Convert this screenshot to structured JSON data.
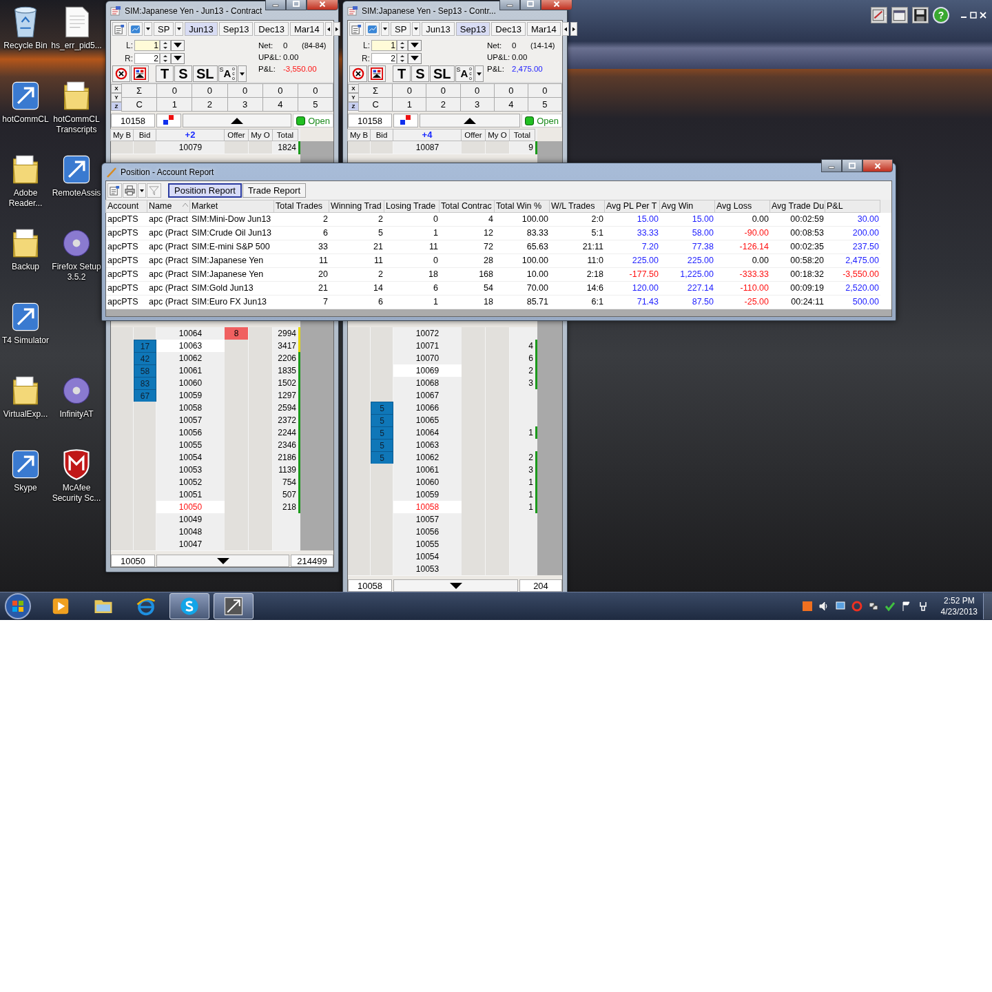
{
  "desktop": {
    "icons": [
      {
        "label": "Recycle Bin",
        "kind": "bin"
      },
      {
        "label": "hs_err_pid5...",
        "kind": "file"
      },
      {
        "label": "hotCommCL",
        "kind": "app"
      },
      {
        "label": "hotCommCL Transcripts",
        "kind": "folder"
      },
      {
        "label": "Adobe Reader...",
        "kind": "folder"
      },
      {
        "label": "RemoteAssis",
        "kind": "app"
      },
      {
        "label": "Backup",
        "kind": "folder"
      },
      {
        "label": "Firefox Setup 3.5.2",
        "kind": "disc"
      },
      {
        "label": "T4 Simulator",
        "kind": "app"
      },
      {
        "kind": "none"
      },
      {
        "label": "VirtualExp...",
        "kind": "folder"
      },
      {
        "label": "InfinityAT",
        "kind": "disc"
      },
      {
        "label": "Skype",
        "kind": "app"
      },
      {
        "label": "McAfee Security Sc...",
        "kind": "shield"
      }
    ]
  },
  "top_window": {
    "help": "?"
  },
  "ladders": [
    {
      "title": "SIM:Japanese Yen - Jun13 - Contract",
      "dropdown": "SP",
      "contracts": [
        {
          "label": "Jun13",
          "selected": true
        },
        {
          "label": "Sep13",
          "selected": false
        },
        {
          "label": "Dec13",
          "selected": false
        },
        {
          "label": "Mar14",
          "selected": false
        }
      ],
      "fields": [
        {
          "label": "L:",
          "value": "1"
        },
        {
          "label": "R:",
          "value": "2"
        }
      ],
      "stats": [
        {
          "label": "Net:",
          "value": "0",
          "extra": "(84-84)"
        },
        {
          "label": "UP&L:",
          "value": "0.00"
        },
        {
          "label": "P&L:",
          "value": "-3,550.00",
          "color": "#ff1010"
        }
      ],
      "order_buttons": [
        "T",
        "S",
        "SL"
      ],
      "oco": {
        "small": "S",
        "label": "A",
        "side": "oco"
      },
      "grid": {
        "axes": [
          {
            "label": "X",
            "selected": false
          },
          {
            "label": "Y",
            "selected": false
          },
          {
            "label": "Z",
            "selected": true
          }
        ],
        "sums": [
          "Σ",
          "0",
          "0",
          "0",
          "0",
          "0"
        ],
        "cols": [
          "C",
          "1",
          "2",
          "3",
          "4",
          "5"
        ]
      },
      "status": {
        "price": "10158",
        "state": "Open"
      },
      "columns": [
        "My B",
        "Bid",
        "+2",
        "Offer",
        "My O",
        "Total"
      ],
      "rows_top": [
        {
          "price": "10079",
          "total": "1824",
          "color": "#1a9a1a",
          "kind": "level"
        }
      ],
      "rows_bottom": [
        {
          "price": "10064",
          "offer": "8",
          "total": "2994",
          "color": "#e6d800",
          "kind": "level"
        },
        {
          "price": "10063",
          "bid": "17",
          "total": "3417",
          "color": "#e6d800",
          "kind": "inside"
        },
        {
          "price": "10062",
          "bid": "42",
          "total": "2206",
          "color": "#1a9a1a",
          "kind": "level"
        },
        {
          "price": "10061",
          "bid": "58",
          "total": "1835",
          "color": "#1a9a1a",
          "kind": "level"
        },
        {
          "price": "10060",
          "bid": "83",
          "total": "1502",
          "color": "#1a9a1a",
          "kind": "level"
        },
        {
          "price": "10059",
          "bid": "67",
          "total": "1297",
          "color": "#1a9a1a",
          "kind": "level"
        },
        {
          "price": "10058",
          "total": "2594",
          "color": "#1a9a1a",
          "kind": "level"
        },
        {
          "price": "10057",
          "total": "2372",
          "color": "#1a9a1a",
          "kind": "level"
        },
        {
          "price": "10056",
          "total": "2244",
          "color": "#1a9a1a",
          "kind": "level"
        },
        {
          "price": "10055",
          "total": "2346",
          "color": "#1a9a1a",
          "kind": "level"
        },
        {
          "price": "10054",
          "total": "2186",
          "color": "#1a9a1a",
          "kind": "level"
        },
        {
          "price": "10053",
          "total": "1139",
          "color": "#1a9a1a",
          "kind": "level"
        },
        {
          "price": "10052",
          "total": "754",
          "color": "#1a9a1a",
          "kind": "level"
        },
        {
          "price": "10051",
          "total": "507",
          "color": "#1a9a1a",
          "kind": "level"
        },
        {
          "price": "10050",
          "total": "218",
          "color": "#1a9a1a",
          "kind": "last"
        },
        {
          "price": "10049",
          "kind": "level"
        },
        {
          "price": "10048",
          "kind": "level"
        },
        {
          "price": "10047",
          "kind": "level"
        }
      ],
      "footer": {
        "price": "10050",
        "total": "214499"
      }
    },
    {
      "title": "SIM:Japanese Yen - Sep13 - Contr...",
      "dropdown": "SP",
      "contracts": [
        {
          "label": "Jun13",
          "selected": false
        },
        {
          "label": "Sep13",
          "selected": true
        },
        {
          "label": "Dec13",
          "selected": false
        },
        {
          "label": "Mar14",
          "selected": false
        }
      ],
      "fields": [
        {
          "label": "L:",
          "value": "1"
        },
        {
          "label": "R:",
          "value": "2"
        }
      ],
      "stats": [
        {
          "label": "Net:",
          "value": "0",
          "extra": "(14-14)"
        },
        {
          "label": "UP&L:",
          "value": "0.00"
        },
        {
          "label": "P&L:",
          "value": "2,475.00",
          "color": "#2020ff"
        }
      ],
      "order_buttons": [
        "T",
        "S",
        "SL"
      ],
      "oco": {
        "small": "S",
        "label": "A",
        "side": "oco"
      },
      "grid": {
        "axes": [
          {
            "label": "X",
            "selected": false
          },
          {
            "label": "Y",
            "selected": false
          },
          {
            "label": "Z",
            "selected": true
          }
        ],
        "sums": [
          "Σ",
          "0",
          "0",
          "0",
          "0",
          "0"
        ],
        "cols": [
          "C",
          "1",
          "2",
          "3",
          "4",
          "5"
        ]
      },
      "status": {
        "price": "10158",
        "state": "Open"
      },
      "columns": [
        "My B",
        "Bid",
        "+4",
        "Offer",
        "My O",
        "Total"
      ],
      "rows_top": [
        {
          "price": "10087",
          "total": "9",
          "color": "#1a9a1a",
          "kind": "level"
        }
      ],
      "rows_bottom": [
        {
          "price": "10072",
          "kind": "level"
        },
        {
          "price": "10071",
          "total": "4",
          "color": "#1a9a1a",
          "kind": "level"
        },
        {
          "price": "10070",
          "total": "6",
          "color": "#1a9a1a",
          "kind": "level"
        },
        {
          "price": "10069",
          "total": "2",
          "color": "#1a9a1a",
          "kind": "inside"
        },
        {
          "price": "10068",
          "total": "3",
          "color": "#1a9a1a",
          "kind": "level"
        },
        {
          "price": "10067",
          "kind": "level"
        },
        {
          "price": "10066",
          "bid": "5",
          "kind": "level"
        },
        {
          "price": "10065",
          "bid": "5",
          "kind": "level"
        },
        {
          "price": "10064",
          "bid": "5",
          "total": "1",
          "color": "#1a9a1a",
          "kind": "level"
        },
        {
          "price": "10063",
          "bid": "5",
          "kind": "level"
        },
        {
          "price": "10062",
          "bid": "5",
          "total": "2",
          "color": "#1a9a1a",
          "kind": "level"
        },
        {
          "price": "10061",
          "total": "3",
          "color": "#1a9a1a",
          "kind": "level"
        },
        {
          "price": "10060",
          "total": "1",
          "color": "#1a9a1a",
          "kind": "level"
        },
        {
          "price": "10059",
          "total": "1",
          "color": "#1a9a1a",
          "kind": "level"
        },
        {
          "price": "10058",
          "total": "1",
          "color": "#1a9a1a",
          "kind": "last"
        },
        {
          "price": "10057",
          "kind": "level"
        },
        {
          "price": "10056",
          "kind": "level"
        },
        {
          "price": "10055",
          "kind": "level"
        },
        {
          "price": "10054",
          "kind": "level"
        },
        {
          "price": "10053",
          "kind": "level"
        }
      ],
      "footer": {
        "price": "10058",
        "total": "204"
      }
    }
  ],
  "report": {
    "title": "Position - Account Report",
    "tabs": [
      {
        "label": "Position Report",
        "selected": true
      },
      {
        "label": "Trade Report",
        "selected": false
      }
    ],
    "columns": [
      "Account",
      "Name",
      "Market",
      "Total Trades",
      "Winning Trad",
      "Losing Trade",
      "Total Contrac",
      "Total Win %",
      "W/L Trades",
      "Avg PL Per T",
      "Avg Win",
      "Avg Loss",
      "Avg Trade Du",
      "P&L"
    ],
    "rows": [
      [
        "apcPTS",
        "apc (Pract",
        "SIM:Mini-Dow Jun13",
        "2",
        "2",
        "0",
        "4",
        "100.00",
        "2:0",
        {
          "text": "15.00",
          "color": "#2020ff"
        },
        {
          "text": "15.00",
          "color": "#2020ff"
        },
        "0.00",
        "00:02:59",
        {
          "text": "30.00",
          "color": "#2020ff"
        }
      ],
      [
        "apcPTS",
        "apc (Pract",
        "SIM:Crude Oil Jun13",
        "6",
        "5",
        "1",
        "12",
        "83.33",
        "5:1",
        {
          "text": "33.33",
          "color": "#2020ff"
        },
        {
          "text": "58.00",
          "color": "#2020ff"
        },
        {
          "text": "-90.00",
          "color": "#ff1010"
        },
        "00:08:53",
        {
          "text": "200.00",
          "color": "#2020ff"
        }
      ],
      [
        "apcPTS",
        "apc (Pract",
        "SIM:E-mini S&P 500",
        "33",
        "21",
        "11",
        "72",
        "65.63",
        "21:11",
        {
          "text": "7.20",
          "color": "#2020ff"
        },
        {
          "text": "77.38",
          "color": "#2020ff"
        },
        {
          "text": "-126.14",
          "color": "#ff1010"
        },
        "00:02:35",
        {
          "text": "237.50",
          "color": "#2020ff"
        }
      ],
      [
        "apcPTS",
        "apc (Pract",
        "SIM:Japanese Yen",
        "11",
        "11",
        "0",
        "28",
        "100.00",
        "11:0",
        {
          "text": "225.00",
          "color": "#2020ff"
        },
        {
          "text": "225.00",
          "color": "#2020ff"
        },
        "0.00",
        "00:58:20",
        {
          "text": "2,475.00",
          "color": "#2020ff"
        }
      ],
      [
        "apcPTS",
        "apc (Pract",
        "SIM:Japanese Yen",
        "20",
        "2",
        "18",
        "168",
        "10.00",
        "2:18",
        {
          "text": "-177.50",
          "color": "#ff1010"
        },
        {
          "text": "1,225.00",
          "color": "#2020ff"
        },
        {
          "text": "-333.33",
          "color": "#ff1010"
        },
        "00:18:32",
        {
          "text": "-3,550.00",
          "color": "#ff1010"
        }
      ],
      [
        "apcPTS",
        "apc (Pract",
        "SIM:Gold Jun13",
        "21",
        "14",
        "6",
        "54",
        "70.00",
        "14:6",
        {
          "text": "120.00",
          "color": "#2020ff"
        },
        {
          "text": "227.14",
          "color": "#2020ff"
        },
        {
          "text": "-110.00",
          "color": "#ff1010"
        },
        "00:09:19",
        {
          "text": "2,520.00",
          "color": "#2020ff"
        }
      ],
      [
        "apcPTS",
        "apc (Pract",
        "SIM:Euro FX Jun13",
        "7",
        "6",
        "1",
        "18",
        "85.71",
        "6:1",
        {
          "text": "71.43",
          "color": "#2020ff"
        },
        {
          "text": "87.50",
          "color": "#2020ff"
        },
        {
          "text": "-25.00",
          "color": "#ff1010"
        },
        "00:24:11",
        {
          "text": "500.00",
          "color": "#2020ff"
        }
      ]
    ]
  },
  "taskbar": {
    "items": [
      {
        "kind": "media",
        "running": false
      },
      {
        "kind": "folder",
        "running": false
      },
      {
        "kind": "browser",
        "running": false
      },
      {
        "kind": "chat",
        "running": true
      },
      {
        "kind": "chart",
        "running": true
      }
    ],
    "time": "2:52 PM",
    "date": "4/23/2013"
  }
}
